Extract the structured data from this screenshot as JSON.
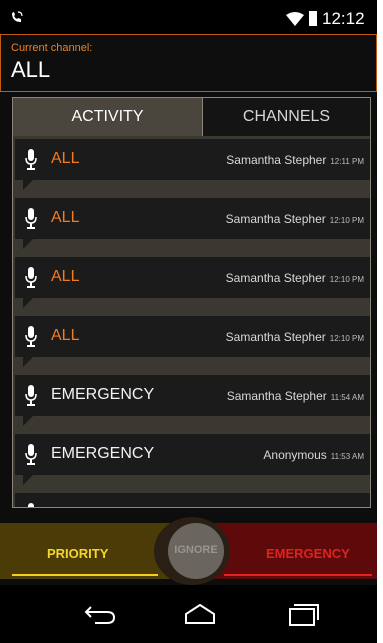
{
  "status_bar": {
    "time": "12:12",
    "icons": [
      "phone-wifi-call-icon",
      "wifi-icon",
      "battery-icon"
    ]
  },
  "channel_header": {
    "label": "Current channel:",
    "value": "ALL"
  },
  "tabs": [
    {
      "label": "ACTIVITY",
      "active": true
    },
    {
      "label": "CHANNELS",
      "active": false
    }
  ],
  "activity": [
    {
      "channel": "ALL",
      "user": "Samantha Stepher",
      "time": "12:11 PM",
      "color": "#f47a20"
    },
    {
      "channel": "ALL",
      "user": "Samantha Stepher",
      "time": "12:10 PM",
      "color": "#f47a20"
    },
    {
      "channel": "ALL",
      "user": "Samantha Stepher",
      "time": "12:10 PM",
      "color": "#f47a20"
    },
    {
      "channel": "ALL",
      "user": "Samantha Stepher",
      "time": "12:10 PM",
      "color": "#f47a20"
    },
    {
      "channel": "EMERGENCY",
      "user": "Samantha Stepher",
      "time": "11:54 AM",
      "color": "#f2f2f2"
    },
    {
      "channel": "EMERGENCY",
      "user": "Anonymous",
      "time": "11:53 AM",
      "color": "#f2f2f2"
    },
    {
      "channel": "",
      "user": "",
      "time": "",
      "color": "#f2f2f2"
    }
  ],
  "priority": {
    "priority_label": "PRIORITY",
    "ignore_label": "IGNORE",
    "emergency_label": "EMERGENCY"
  },
  "nav": {
    "icons": [
      "back-icon",
      "home-icon",
      "recents-icon"
    ]
  },
  "colors": {
    "accent": "#f47a20",
    "priority": "#f5d62c",
    "emergency": "#e32020"
  }
}
